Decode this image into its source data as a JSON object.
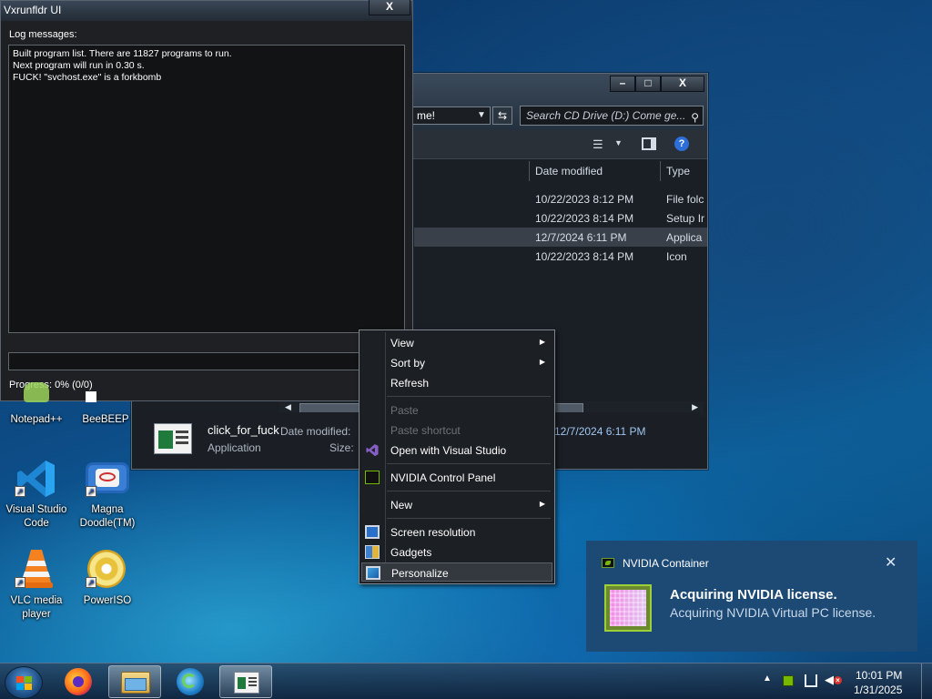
{
  "log_window": {
    "title": "Vxrunfldr UI",
    "close_label": "X",
    "log_label": "Log messages:",
    "log_lines": [
      "Built program list. There are 11827 programs to run.",
      "Next program will run in 0.30 s.",
      "FUCK! \"svchost.exe\" is a forkbomb"
    ],
    "progress_text": "Progress: 0% (0/0)",
    "progress_fraction": 0
  },
  "explorer": {
    "min_label": "–",
    "max_label": "□",
    "close_label": "X",
    "address_text": "me!",
    "search_placeholder": "Search CD Drive (D:) Come ge...",
    "columns": {
      "date_modified": "Date modified",
      "type": "Type"
    },
    "rows": [
      {
        "date": "10/22/2023 8:12 PM",
        "type": "File folc",
        "selected": false
      },
      {
        "date": "10/22/2023 8:14 PM",
        "type": "Setup Ir",
        "selected": false
      },
      {
        "date": "12/7/2024 6:11 PM",
        "type": "Applica",
        "selected": true
      },
      {
        "date": "10/22/2023 8:14 PM",
        "type": "Icon",
        "selected": false
      }
    ],
    "details": {
      "name": "click_for_fuck",
      "type": "Application",
      "date_modified_label": "Date modified:",
      "size_label": "Size:",
      "date_modified_value": "12/7/2024 6:11 PM"
    }
  },
  "desktop_icons": [
    {
      "label": "Notepad++"
    },
    {
      "label": "BeeBEEP"
    },
    {
      "label": "Visual Studio Code"
    },
    {
      "label": "Magna Doodle(TM)"
    },
    {
      "label": "VLC media player"
    },
    {
      "label": "PowerISO"
    }
  ],
  "context_menu": {
    "items": [
      {
        "label": "View",
        "submenu": true,
        "disabled": false
      },
      {
        "label": "Sort by",
        "submenu": true,
        "disabled": false
      },
      {
        "label": "Refresh",
        "submenu": false,
        "disabled": false
      },
      {
        "label": "Paste",
        "submenu": false,
        "disabled": true
      },
      {
        "label": "Paste shortcut",
        "submenu": false,
        "disabled": true
      },
      {
        "label": "Open with Visual Studio",
        "submenu": false,
        "disabled": false
      },
      {
        "label": "NVIDIA Control Panel",
        "submenu": false,
        "disabled": false
      },
      {
        "label": "New",
        "submenu": true,
        "disabled": false
      },
      {
        "label": "Screen resolution",
        "submenu": false,
        "disabled": false
      },
      {
        "label": "Gadgets",
        "submenu": false,
        "disabled": false
      },
      {
        "label": "Personalize",
        "submenu": false,
        "disabled": false
      }
    ]
  },
  "notification": {
    "app_name": "NVIDIA Container",
    "close_label": "✕",
    "title": "Acquiring NVIDIA license.",
    "body": "Acquiring NVIDIA Virtual PC license."
  },
  "taskbar": {
    "clock_time": "10:01 PM",
    "clock_date": "1/31/2025",
    "tray_arrow": "▲"
  },
  "colors": {
    "nvidia_green": "#76b900",
    "visual_studio_purple": "#865fc5",
    "vscode_blue": "#1f86d4",
    "toast_bg": "#1d4a75"
  }
}
